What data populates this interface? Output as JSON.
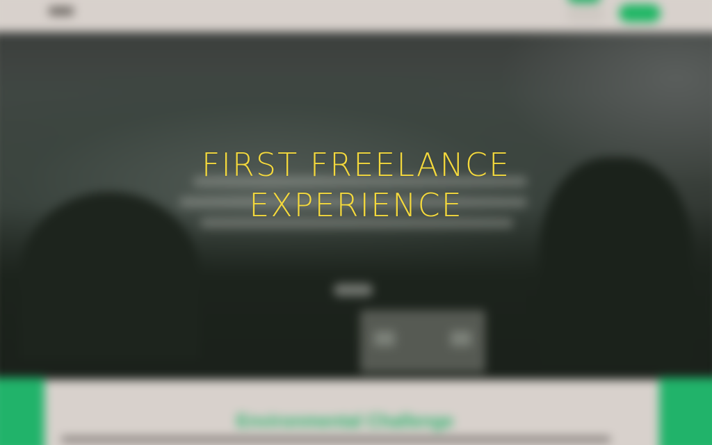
{
  "hero": {
    "title_line_1": "FIRST FREELANCE",
    "title_line_2": "EXPERIENCE"
  },
  "section": {
    "heading": "Environmental Challenge"
  },
  "colors": {
    "title_yellow": "#f4d93d",
    "accent_green": "#21b36a",
    "page_background": "#d6d0cb"
  }
}
